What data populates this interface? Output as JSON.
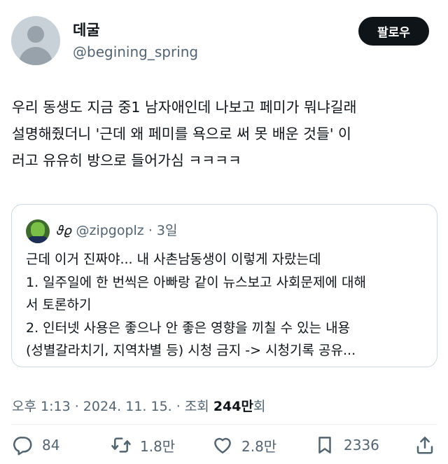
{
  "author": {
    "display_name": "데굴",
    "handle": "@begining_spring",
    "avatar_icon": "default-avatar-icon"
  },
  "follow_button": {
    "label": "팔로우"
  },
  "tweet": {
    "lines": [
      "우리 동생도 지금 중1 남자애인데 나보고 페미가 뭐냐길래",
      "설명해줬더니 '근데 왜 페미를 욕으로 써 못 배운 것들' 이",
      "러고 유유히 방으로 들어가심 ㅋㅋㅋㅋ"
    ]
  },
  "quote": {
    "display_name": "𝜗𝜚",
    "handle": "@zipgoplz",
    "separator": "·",
    "age": "3일",
    "lines": [
      "근데 이거 진짜야... 내 사촌남동생이 이렇게 자랐는데",
      "1. 일주일에 한 번씩은 아빠랑 같이 뉴스보고 사회문제에 대해",
      "서 토론하기",
      "2. 인터넷 사용은 좋으나 안 좋은 영향을 끼칠 수 있는 내용",
      "(성별갈라치기, 지역차별 등) 시청 금지 -> 시청기록 공유..."
    ]
  },
  "meta": {
    "time": "오후 1:13",
    "sep1": " · ",
    "date": "2024. 11. 15.",
    "sep2": " · ",
    "views_label": "조회 ",
    "views_count": "244만",
    "views_suffix": "회"
  },
  "actions": {
    "replies": "84",
    "retweets": "1.8만",
    "likes": "2.8만",
    "bookmarks": "2336"
  },
  "colors": {
    "text": "#0f1419",
    "secondary": "#536471",
    "border": "#cfd9de",
    "follow_bg": "#0f1419"
  }
}
